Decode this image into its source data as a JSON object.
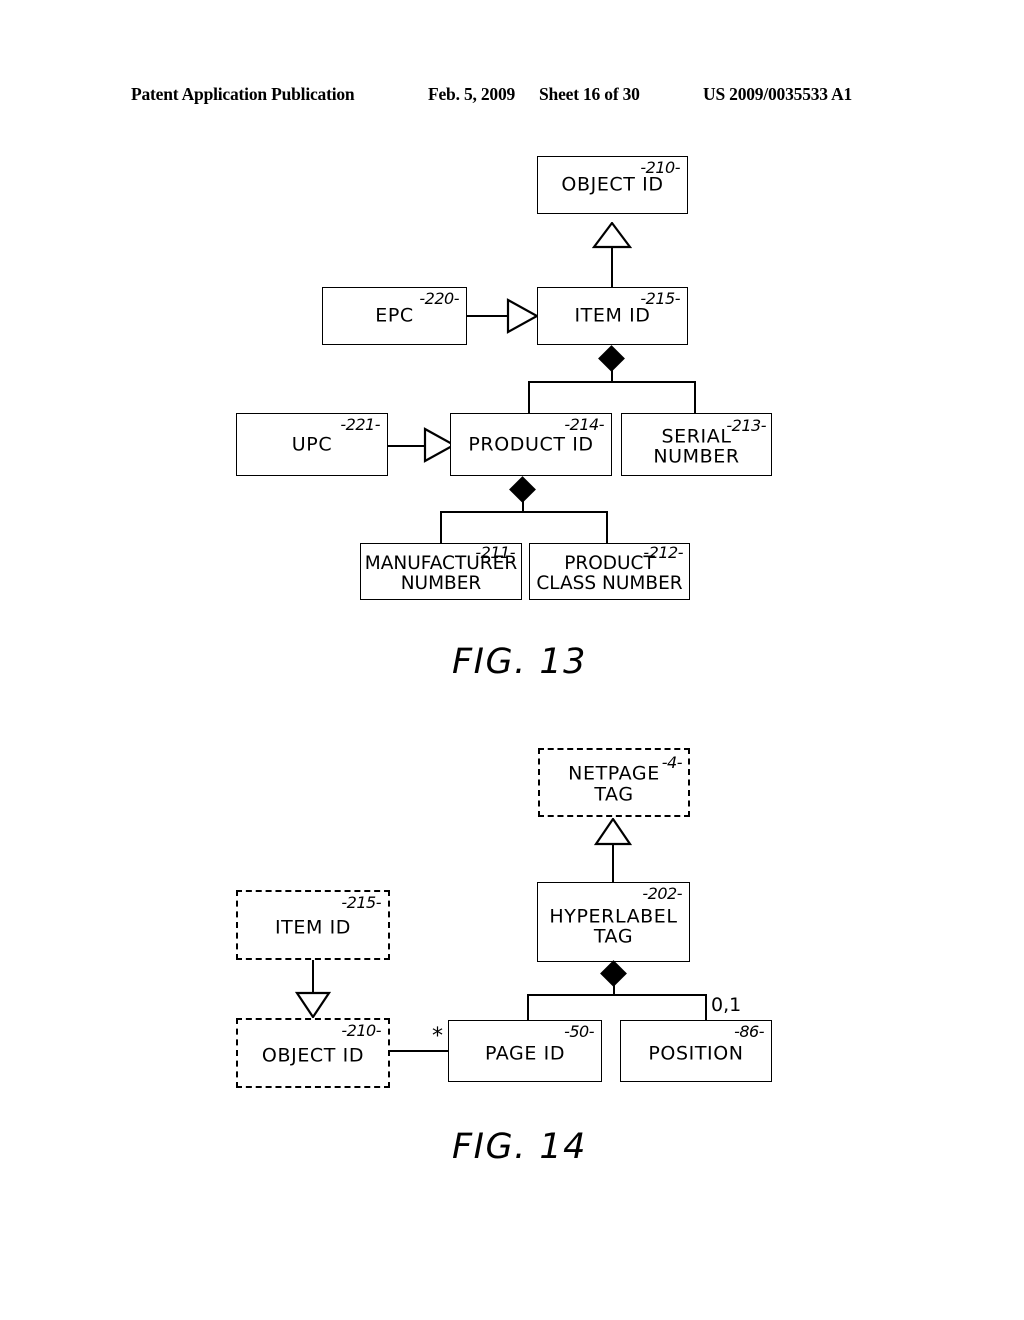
{
  "header": {
    "publication": "Patent Application Publication",
    "date": "Feb. 5, 2009",
    "sheet": "Sheet 16 of 30",
    "patent_number": "US 2009/0035533 A1"
  },
  "figures": [
    {
      "caption": "FIG. 13",
      "nodes": [
        {
          "id": "object-id",
          "label": "OBJECT ID",
          "ref": "-210-",
          "style": "solid"
        },
        {
          "id": "epc",
          "label": "EPC",
          "ref": "-220-",
          "style": "solid"
        },
        {
          "id": "item-id",
          "label": "ITEM ID",
          "ref": "-215-",
          "style": "solid"
        },
        {
          "id": "upc",
          "label": "UPC",
          "ref": "-221-",
          "style": "solid"
        },
        {
          "id": "product-id",
          "label": "PRODUCT ID",
          "ref": "-214-",
          "style": "solid"
        },
        {
          "id": "serial-number",
          "label": "SERIAL\nNUMBER",
          "ref": "-213-",
          "style": "solid"
        },
        {
          "id": "manufacturer-number",
          "label": "MANUFACTURER\nNUMBER",
          "ref": "-211-",
          "style": "solid"
        },
        {
          "id": "product-class-number",
          "label": "PRODUCT\nCLASS NUMBER",
          "ref": "-212-",
          "style": "solid"
        }
      ],
      "relations": [
        {
          "from": "item-id",
          "to": "object-id",
          "type": "generalization"
        },
        {
          "from": "epc",
          "to": "item-id",
          "type": "realization"
        },
        {
          "from": "item-id",
          "to": "product-id",
          "type": "composition"
        },
        {
          "from": "item-id",
          "to": "serial-number",
          "type": "composition"
        },
        {
          "from": "upc",
          "to": "product-id",
          "type": "realization"
        },
        {
          "from": "product-id",
          "to": "manufacturer-number",
          "type": "composition"
        },
        {
          "from": "product-id",
          "to": "product-class-number",
          "type": "composition"
        }
      ]
    },
    {
      "caption": "FIG. 14",
      "nodes": [
        {
          "id": "netpage-tag",
          "label": "NETPAGE\nTAG",
          "ref": "-4-",
          "style": "dashed"
        },
        {
          "id": "hyperlabel-tag",
          "label": "HYPERLABEL\nTAG",
          "ref": "-202-",
          "style": "solid"
        },
        {
          "id": "item-id-14",
          "label": "ITEM ID",
          "ref": "-215-",
          "style": "dashed"
        },
        {
          "id": "object-id-14",
          "label": "OBJECT ID",
          "ref": "-210-",
          "style": "dashed"
        },
        {
          "id": "page-id",
          "label": "PAGE ID",
          "ref": "-50-",
          "style": "solid"
        },
        {
          "id": "position",
          "label": "POSITION",
          "ref": "-86-",
          "style": "solid"
        }
      ],
      "relations": [
        {
          "from": "hyperlabel-tag",
          "to": "netpage-tag",
          "type": "generalization"
        },
        {
          "from": "item-id-14",
          "to": "object-id-14",
          "type": "generalization"
        },
        {
          "from": "hyperlabel-tag",
          "to": "page-id",
          "type": "composition"
        },
        {
          "from": "hyperlabel-tag",
          "to": "position",
          "type": "composition",
          "multiplicity": "0,1"
        },
        {
          "from": "object-id-14",
          "to": "page-id",
          "type": "association",
          "multiplicity": "*"
        }
      ],
      "multiplicity_labels": [
        {
          "id": "page-id-multiplicity",
          "value": "*"
        },
        {
          "id": "position-multiplicity",
          "value": "0,1"
        }
      ]
    }
  ]
}
